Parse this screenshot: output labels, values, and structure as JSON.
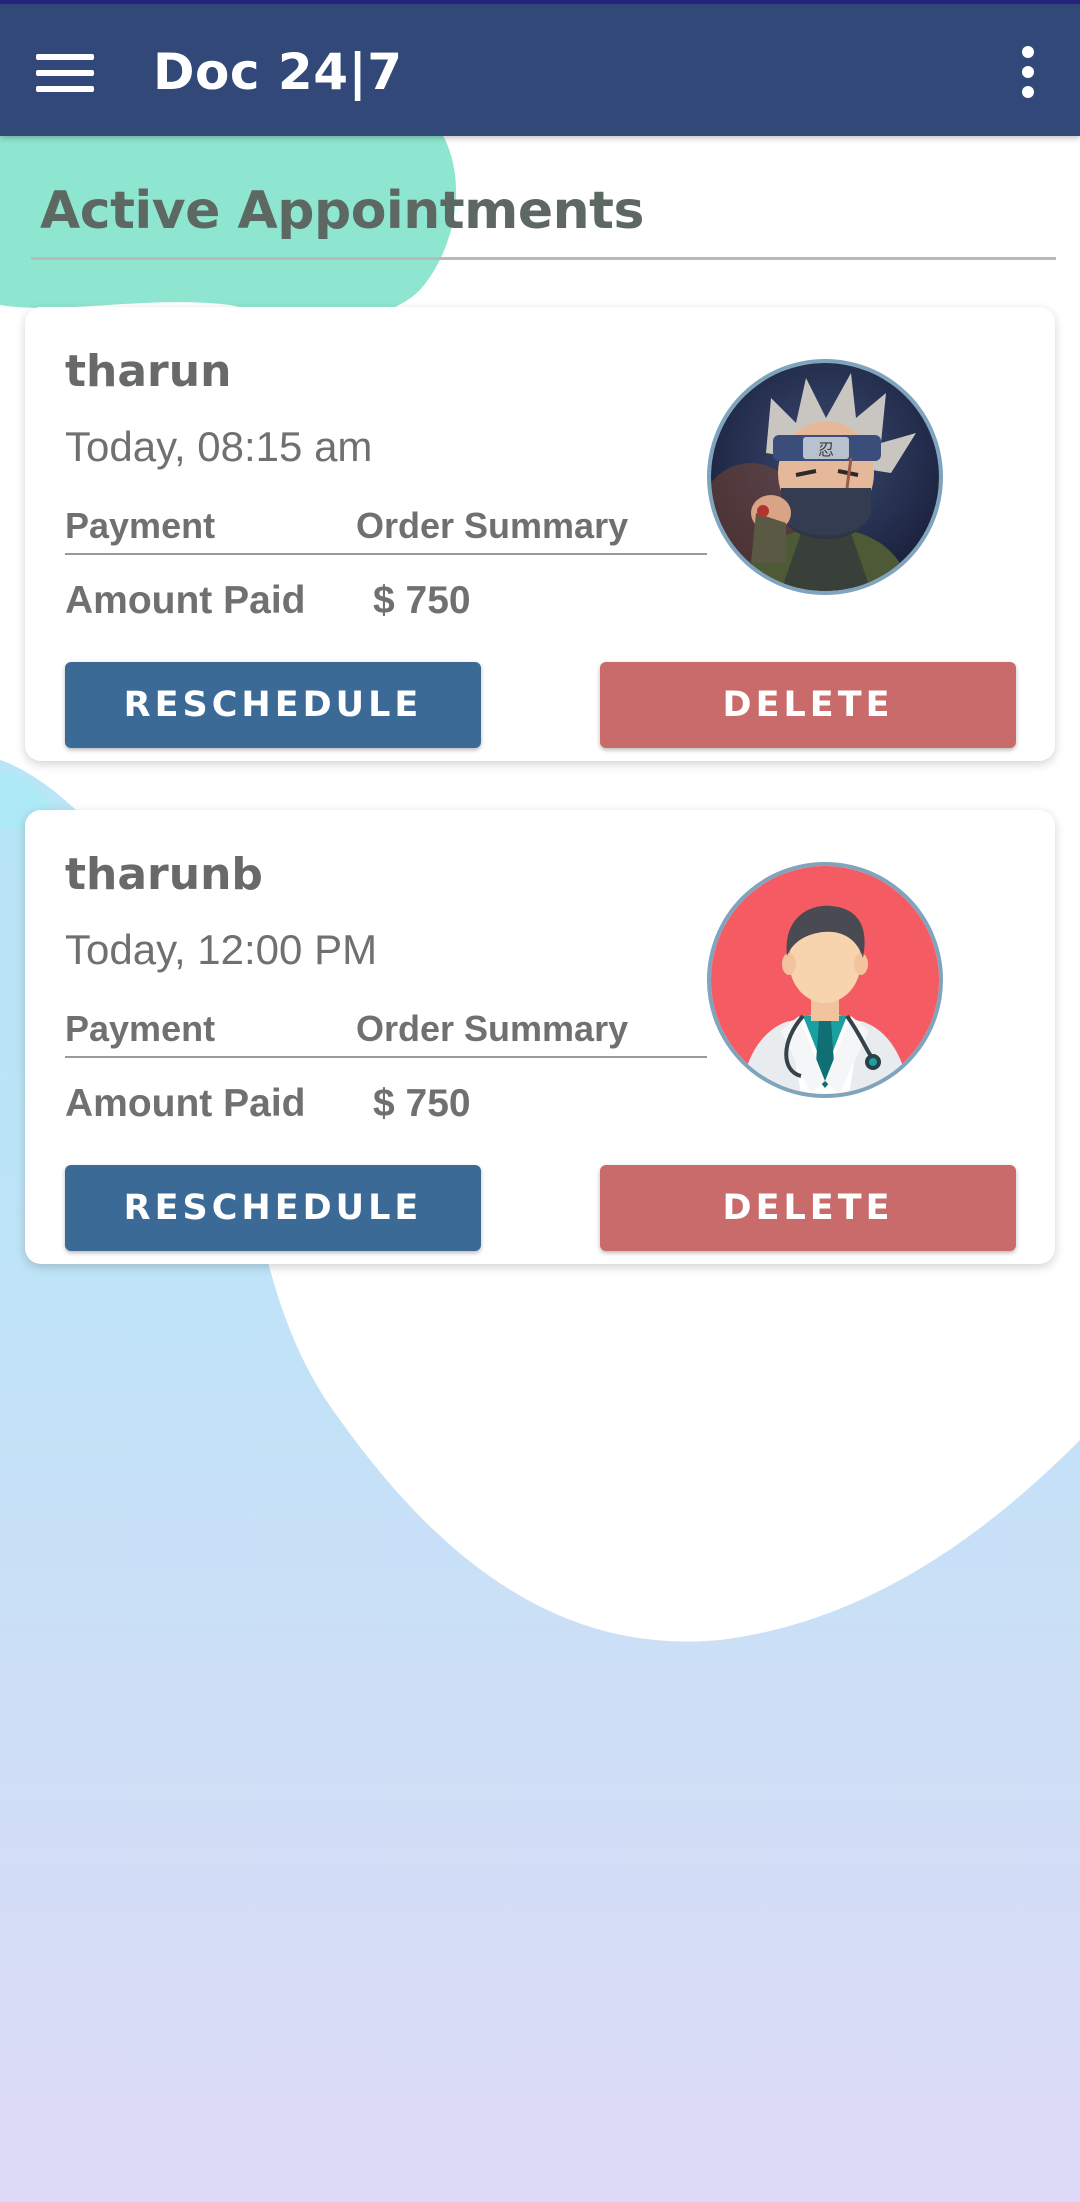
{
  "app_bar": {
    "title": "Doc 24|7"
  },
  "page": {
    "section_title": "Active Appointments"
  },
  "appointments": [
    {
      "name": "tharun",
      "time": "Today,  08:15 am",
      "payment_label": "Payment",
      "order_summary_label": "Order Summary",
      "amount_label": "Amount Paid",
      "amount_value": "$ 750",
      "reschedule_label": "RESCHEDULE",
      "delete_label": "DELETE",
      "avatar": "anime-ninja-avatar"
    },
    {
      "name": "tharunb",
      "time": "Today,  12:00 PM",
      "payment_label": "Payment",
      "order_summary_label": "Order Summary",
      "amount_label": "Amount Paid",
      "amount_value": "$ 750",
      "reschedule_label": "RESCHEDULE",
      "delete_label": "DELETE",
      "avatar": "doctor-avatar"
    }
  ],
  "colors": {
    "app_bar": "#314879",
    "reschedule_button": "#3c6a97",
    "delete_button": "#c96b6b",
    "doctor_avatar_bg": "#f45b63"
  }
}
